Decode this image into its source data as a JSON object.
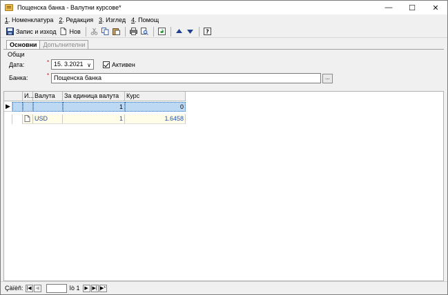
{
  "window": {
    "title": "Пощенска банка - Валутни курсове*",
    "controls": {
      "minimize": "—",
      "maximize": "☐",
      "close": "✕"
    }
  },
  "menu": [
    {
      "key": "1",
      "label": ". Номенклатура"
    },
    {
      "key": "2",
      "label": ". Редакция"
    },
    {
      "key": "3",
      "label": ". Изглед"
    },
    {
      "key": "4",
      "label": ". Помощ"
    }
  ],
  "toolbar": {
    "save_label": "Запис и изход",
    "new_label": "Нов"
  },
  "tabs": {
    "main": "Основни",
    "extra": "Допълнителни"
  },
  "form": {
    "group_title": "Общи",
    "date_label": "Дата:",
    "date_value": "15.  3.2021",
    "active_label": "Активен",
    "bank_label": "Банка:",
    "bank_value": "Пощенска банка",
    "dots_label": "..."
  },
  "grid": {
    "columns": [
      "И...",
      "Валута",
      "За единица валута",
      "Курс"
    ],
    "filter_row": {
      "per_unit": "1",
      "rate": "0"
    },
    "rows": [
      {
        "currency": "USD",
        "per_unit": "1",
        "rate": "1.6458"
      }
    ]
  },
  "statusbar": {
    "record_label": "Çàïèñ:",
    "of_label": "îò 1"
  },
  "colors": {
    "selected_row": "#bcd8f3",
    "data_row": "#fffde8",
    "link_text": "#1f4fb0"
  }
}
